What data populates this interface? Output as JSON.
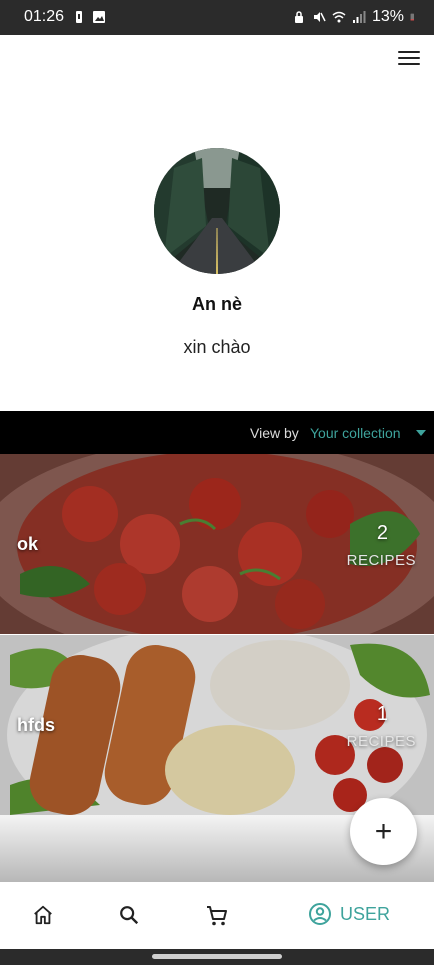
{
  "status_bar": {
    "time": "01:26",
    "battery": "13%"
  },
  "profile": {
    "name": "An nè",
    "bio": "xin chào"
  },
  "view_by": {
    "label": "View by",
    "selected": "Your collection"
  },
  "collections": [
    {
      "title": "ok",
      "count": "2",
      "unit": "RECIPES"
    },
    {
      "title": "hfds",
      "count": "1",
      "unit": "RECIPES"
    }
  ],
  "fab": {
    "label": "+"
  },
  "bottom_nav": {
    "items": [
      {
        "icon": "home-icon"
      },
      {
        "icon": "search-icon"
      },
      {
        "icon": "cart-icon"
      },
      {
        "icon": "user-circle-icon",
        "label": "USER",
        "active": true
      }
    ]
  },
  "colors": {
    "accent": "#3ea39c",
    "status_bar": "#2b2b2b"
  }
}
